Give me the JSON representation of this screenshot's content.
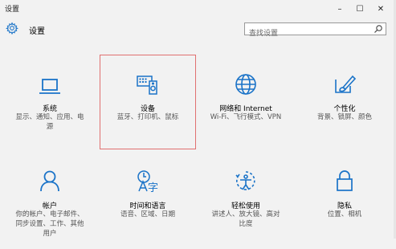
{
  "window": {
    "title": "设置",
    "minimize": "–",
    "maximize": "☐",
    "close": "✕"
  },
  "header": {
    "title": "设置",
    "search_placeholder": "查找设置"
  },
  "tiles": [
    {
      "label": "系统",
      "desc": "显示、通知、应用、电\n源",
      "icon": "laptop-icon"
    },
    {
      "label": "设备",
      "desc": "蓝牙、打印机、鼠标",
      "icon": "keyboard-speaker-icon"
    },
    {
      "label": "网络和 Internet",
      "desc": "Wi-Fi、飞行模式、VPN",
      "icon": "globe-icon"
    },
    {
      "label": "个性化",
      "desc": "背景、锁屏、颜色",
      "icon": "paint-icon"
    },
    {
      "label": "帐户",
      "desc": "你的帐户、电子邮件、\n同步设置、工作、其他\n用户",
      "icon": "person-icon"
    },
    {
      "label": "时间和语言",
      "desc": "语音、区域、日期",
      "icon": "time-language-icon"
    },
    {
      "label": "轻松使用",
      "desc": "讲述人、放大镜、高对\n比度",
      "icon": "ease-of-access-icon"
    },
    {
      "label": "隐私",
      "desc": "位置、相机",
      "icon": "lock-icon"
    }
  ],
  "colors": {
    "accent": "#1a73c8",
    "selection_border": "#e07070"
  }
}
